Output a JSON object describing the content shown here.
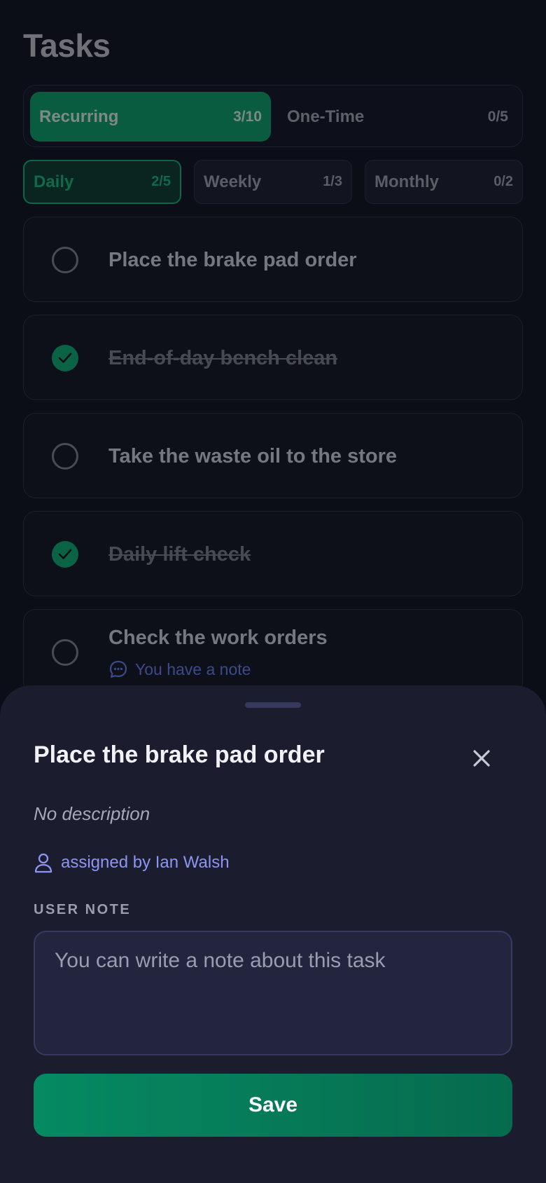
{
  "header": {
    "title": "Tasks"
  },
  "segments": [
    {
      "label": "Recurring",
      "count": "3/10",
      "active": true
    },
    {
      "label": "One-Time",
      "count": "0/5",
      "active": false
    }
  ],
  "filters": [
    {
      "label": "Daily",
      "count": "2/5",
      "active": true
    },
    {
      "label": "Weekly",
      "count": "1/3",
      "active": false
    },
    {
      "label": "Monthly",
      "count": "0/2",
      "active": false
    }
  ],
  "tasks": [
    {
      "label": "Place the brake pad order",
      "done": false
    },
    {
      "label": "End-of-day bench clean",
      "done": true
    },
    {
      "label": "Take the waste oil to the store",
      "done": false
    },
    {
      "label": "Daily lift check",
      "done": true
    },
    {
      "label": "Check the work orders",
      "done": false,
      "note": "You have a note"
    }
  ],
  "sheet": {
    "title": "Place the brake pad order",
    "description": "No description",
    "assigned": "assigned by Ian Walsh",
    "note_heading": "USER NOTE",
    "note_placeholder": "You can write a note about this task",
    "note_value": "",
    "save_label": "Save"
  },
  "colors": {
    "accent": "#058a62",
    "link": "#8c96f2",
    "background": "#0b0d17",
    "sheet": "#1b1d2f"
  }
}
